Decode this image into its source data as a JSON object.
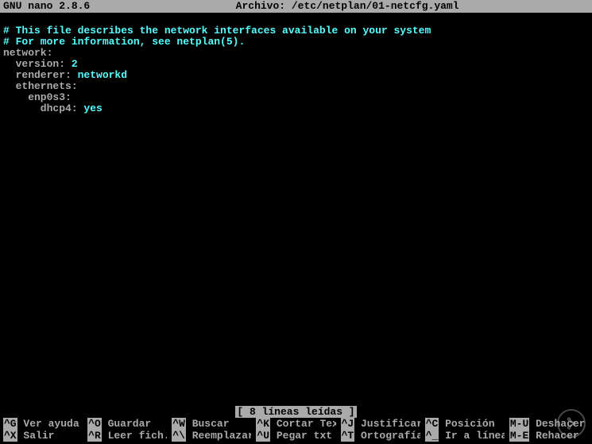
{
  "titlebar": {
    "app": "GNU nano 2.8.6",
    "file_label": "Archivo: /etc/netplan/01-netcfg.yaml"
  },
  "file": {
    "comment1": "# This file describes the network interfaces available on your system",
    "comment2": "# For more information, see netplan(5).",
    "l1": "network:",
    "l2": "  version: ",
    "l2v": "2",
    "l3": "  renderer: ",
    "l3v": "networkd",
    "l4": "  ethernets:",
    "l5": "    enp0s3:",
    "l6": "      dhcp4: ",
    "l6v": "yes"
  },
  "status": "[ 8 líneas leídas ]",
  "help": {
    "r1c1": {
      "key": "^G",
      "label": "Ver ayuda"
    },
    "r1c2": {
      "key": "^O",
      "label": "Guardar"
    },
    "r1c3": {
      "key": "^W",
      "label": "Buscar"
    },
    "r1c4": {
      "key": "^K",
      "label": "Cortar Text"
    },
    "r1c5": {
      "key": "^J",
      "label": "Justificar"
    },
    "r1c6": {
      "key": "^C",
      "label": "Posición"
    },
    "r1c7": {
      "key": "M-U",
      "label": "Deshacer"
    },
    "r2c1": {
      "key": "^X",
      "label": "Salir"
    },
    "r2c2": {
      "key": "^R",
      "label": "Leer fich."
    },
    "r2c3": {
      "key": "^\\",
      "label": "Reemplazar"
    },
    "r2c4": {
      "key": "^U",
      "label": "Pegar txt"
    },
    "r2c5": {
      "key": "^T",
      "label": "Ortografía"
    },
    "r2c6": {
      "key": "^_",
      "label": "Ir a línea"
    },
    "r2c7": {
      "key": "M-E",
      "label": "Rehacer"
    }
  }
}
